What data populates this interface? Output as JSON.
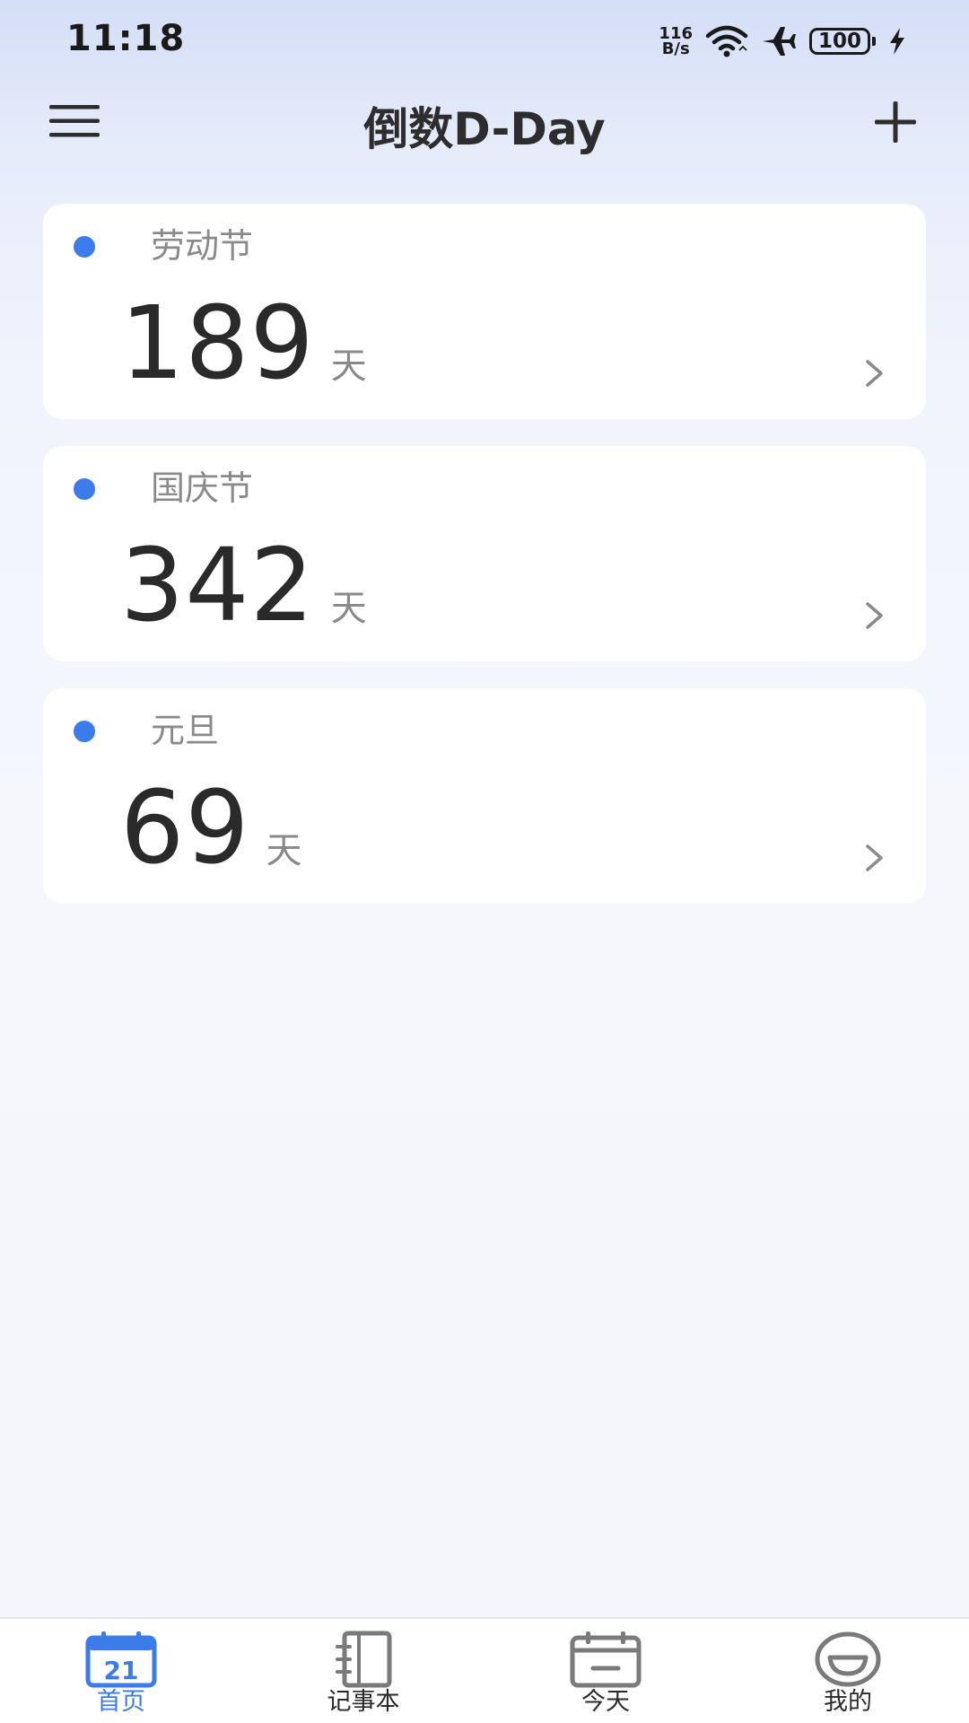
{
  "status_bar": {
    "time": "11:18",
    "net_speed_value": "116",
    "net_speed_unit": "B/s",
    "battery": "100"
  },
  "header": {
    "title": "倒数D-Day"
  },
  "events": [
    {
      "name": "劳动节",
      "days": "189",
      "unit": "天"
    },
    {
      "name": "国庆节",
      "days": "342",
      "unit": "天"
    },
    {
      "name": "元旦",
      "days": "69",
      "unit": "天"
    }
  ],
  "bottom_nav": {
    "home": {
      "label": "首页",
      "icon_text": "21"
    },
    "notebook": {
      "label": "记事本"
    },
    "today": {
      "label": "今天"
    },
    "mine": {
      "label": "我的"
    }
  },
  "colors": {
    "accent": "#3b7bea",
    "text_dark": "#2a2a2a",
    "text_muted": "#8a8a8a"
  }
}
